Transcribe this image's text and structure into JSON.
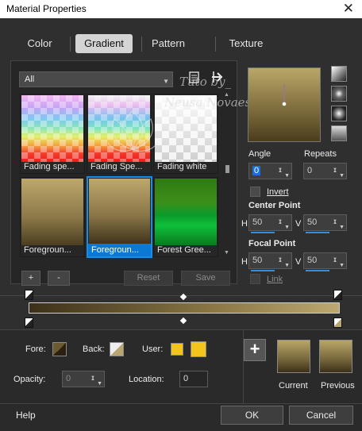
{
  "window": {
    "title": "Material Properties",
    "close_glyph": "✕"
  },
  "tabs": [
    {
      "label": "Color"
    },
    {
      "label": "Gradient"
    },
    {
      "label": "Pattern"
    },
    {
      "label": "Texture"
    }
  ],
  "library": {
    "category": "All",
    "thumbnails": [
      {
        "label": "Fading spe..."
      },
      {
        "label": "Fading Spe..."
      },
      {
        "label": "Fading white"
      },
      {
        "label": "Foregroun..."
      },
      {
        "label": "Foregroun..."
      },
      {
        "label": "Forest Gree..."
      }
    ],
    "add_label": "+",
    "remove_label": "-",
    "reset_label": "Reset",
    "save_label": "Save"
  },
  "watermark": {
    "line1": "Tuto by_",
    "line2": "Neusa Novaes"
  },
  "settings": {
    "angle_label": "Angle",
    "angle_value": "0",
    "repeats_label": "Repeats",
    "repeats_value": "0",
    "invert_label": "Invert",
    "center_point_label": "Center Point",
    "center_h_label": "H",
    "center_h_value": "50",
    "center_v_label": "V",
    "center_v_value": "50",
    "focal_point_label": "Focal Point",
    "focal_h_label": "H",
    "focal_h_value": "50",
    "focal_v_label": "V",
    "focal_v_value": "50",
    "link_label": "Link"
  },
  "stops": {
    "fore_label": "Fore:",
    "back_label": "Back:",
    "user_label": "User:",
    "user_color": "#f2c41c",
    "opacity_label": "Opacity:",
    "opacity_value": "0",
    "location_label": "Location:",
    "location_value": "0"
  },
  "preview": {
    "add_glyph": "+",
    "current_label": "Current",
    "previous_label": "Previous"
  },
  "footer": {
    "help_label": "Help",
    "ok_label": "OK",
    "cancel_label": "Cancel"
  },
  "colors": {
    "accent": "#1c8be0",
    "bg": "#2f2f2f"
  }
}
